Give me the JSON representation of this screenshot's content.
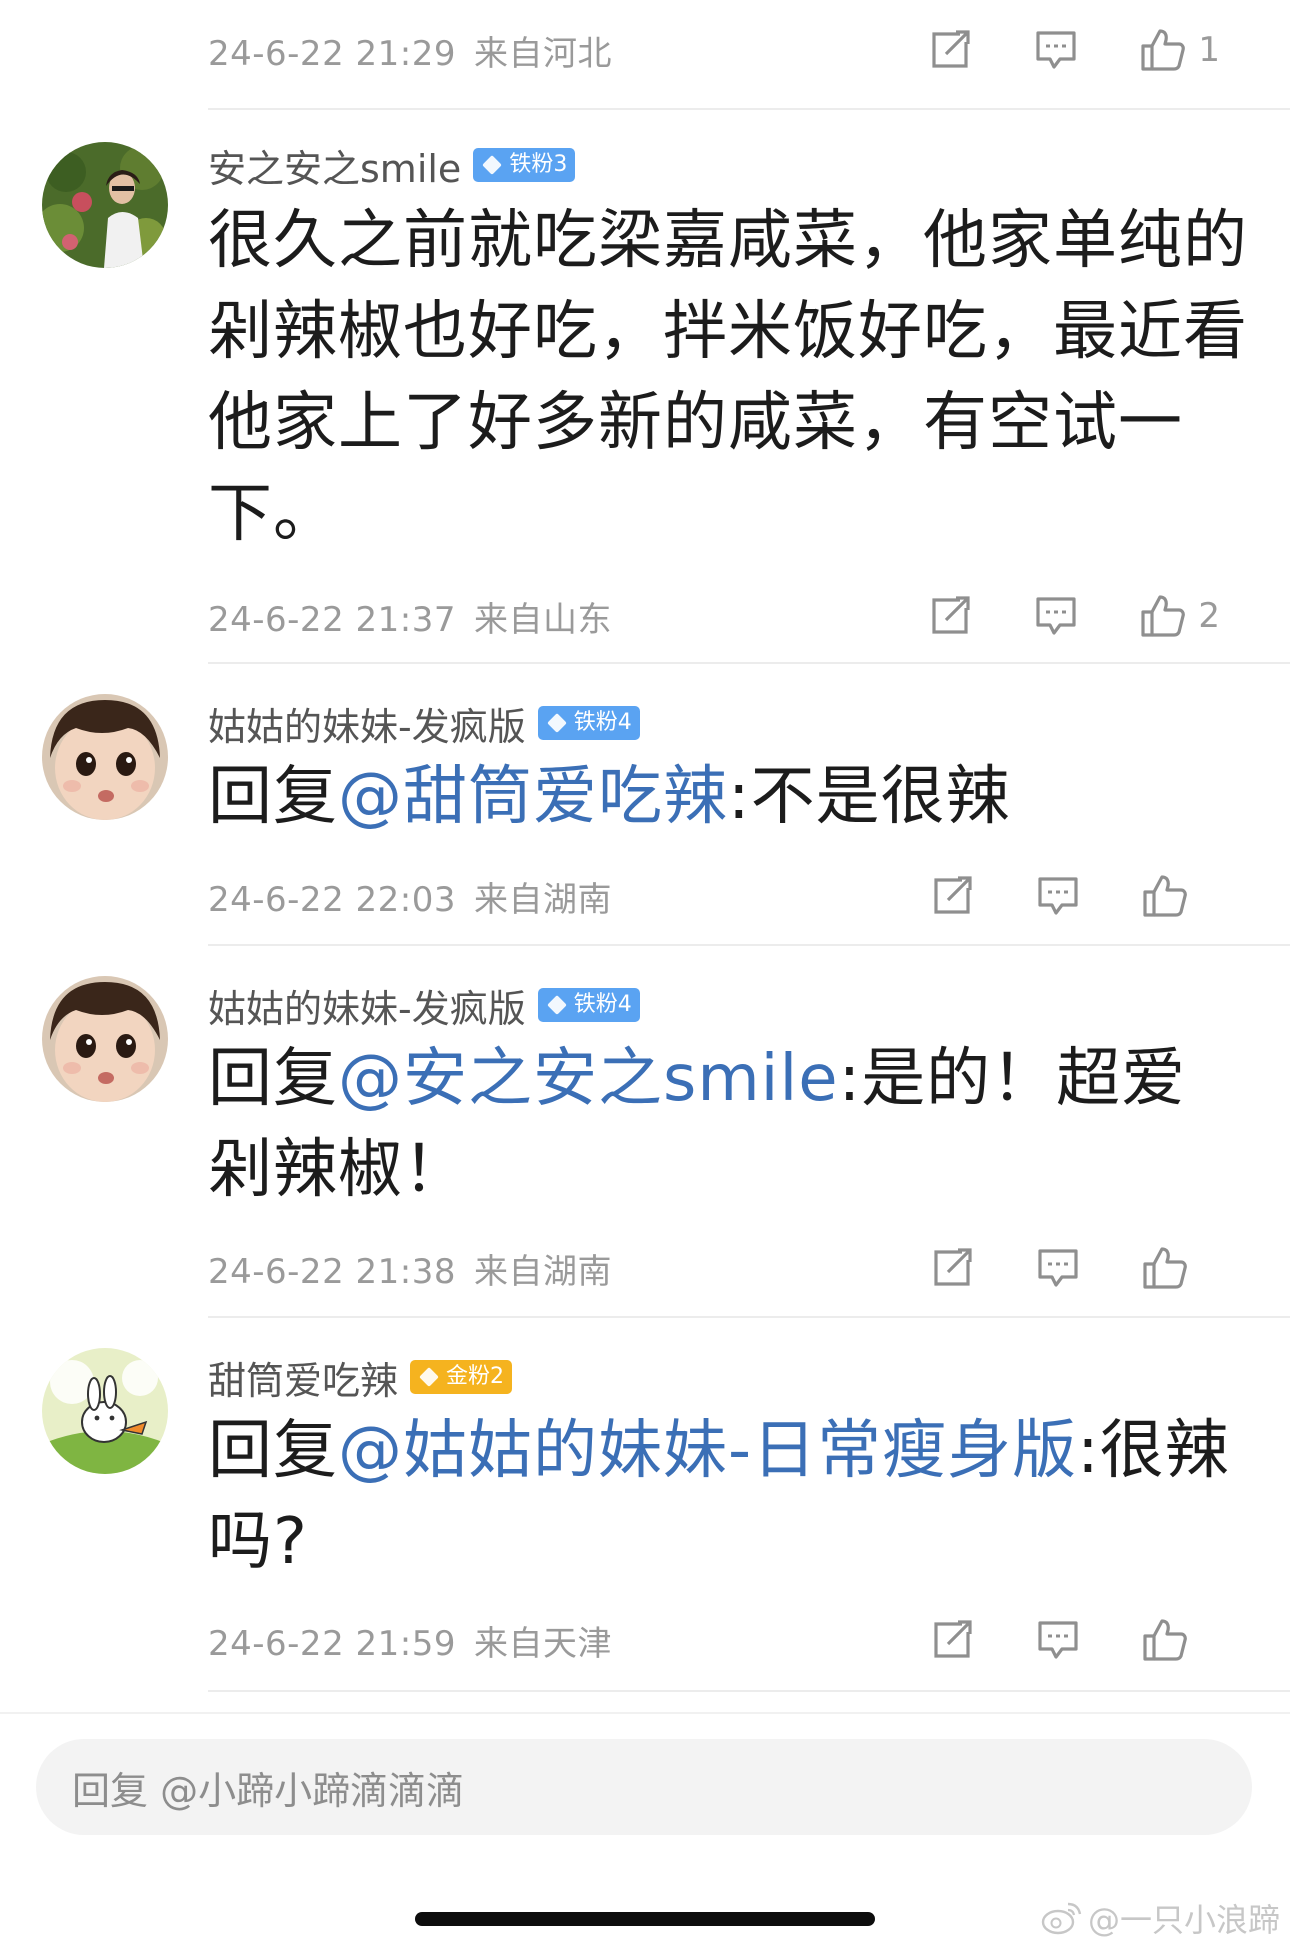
{
  "comments": [
    {
      "timestamp": "24-6-22 21:29",
      "location": "来自河北",
      "likes": "1"
    },
    {
      "username": "安之安之smile",
      "badge": "铁粉3",
      "badge_color": "#5aa3f2",
      "text": "很久之前就吃梁嘉咸菜，他家单纯的剁辣椒也好吃，拌米饭好吃，最近看他家上了好多新的咸菜，有空试一下。",
      "timestamp": "24-6-22 21:37",
      "location": "来自山东",
      "likes": "2"
    },
    {
      "username": "姑姑的妹妹-发疯版",
      "badge": "铁粉4",
      "badge_color": "#5aa3f2",
      "reply_prefix": "回复",
      "mention": "@甜筒爱吃辣",
      "text": ":不是很辣",
      "timestamp": "24-6-22 22:03",
      "location": "来自湖南",
      "likes": ""
    },
    {
      "username": "姑姑的妹妹-发疯版",
      "badge": "铁粉4",
      "badge_color": "#5aa3f2",
      "reply_prefix": "回复",
      "mention": "@安之安之smile",
      "text": ":是的！超爱剁辣椒！",
      "timestamp": "24-6-22 21:38",
      "location": "来自湖南",
      "likes": ""
    },
    {
      "username": "甜筒爱吃辣",
      "badge": "金粉2",
      "badge_color": "#f5b31f",
      "reply_prefix": "回复",
      "mention": "@姑姑的妹妹-日常瘦身版",
      "text": ":很辣吗?",
      "timestamp": "24-6-22 21:59",
      "location": "来自天津",
      "likes": ""
    }
  ],
  "reply_input": {
    "placeholder": "回复 @小蹄小蹄滴滴滴"
  },
  "watermark": "@一只小浪蹄",
  "icons": {
    "share": "share-icon",
    "comment": "comment-icon",
    "like": "thumbs-up-icon",
    "weibo": "weibo-logo-icon"
  },
  "colors": {
    "mention": "#3b6fb6",
    "meta": "#9a9a9a",
    "iron_badge": "#5aa3f2",
    "gold_badge": "#f5b31f"
  }
}
